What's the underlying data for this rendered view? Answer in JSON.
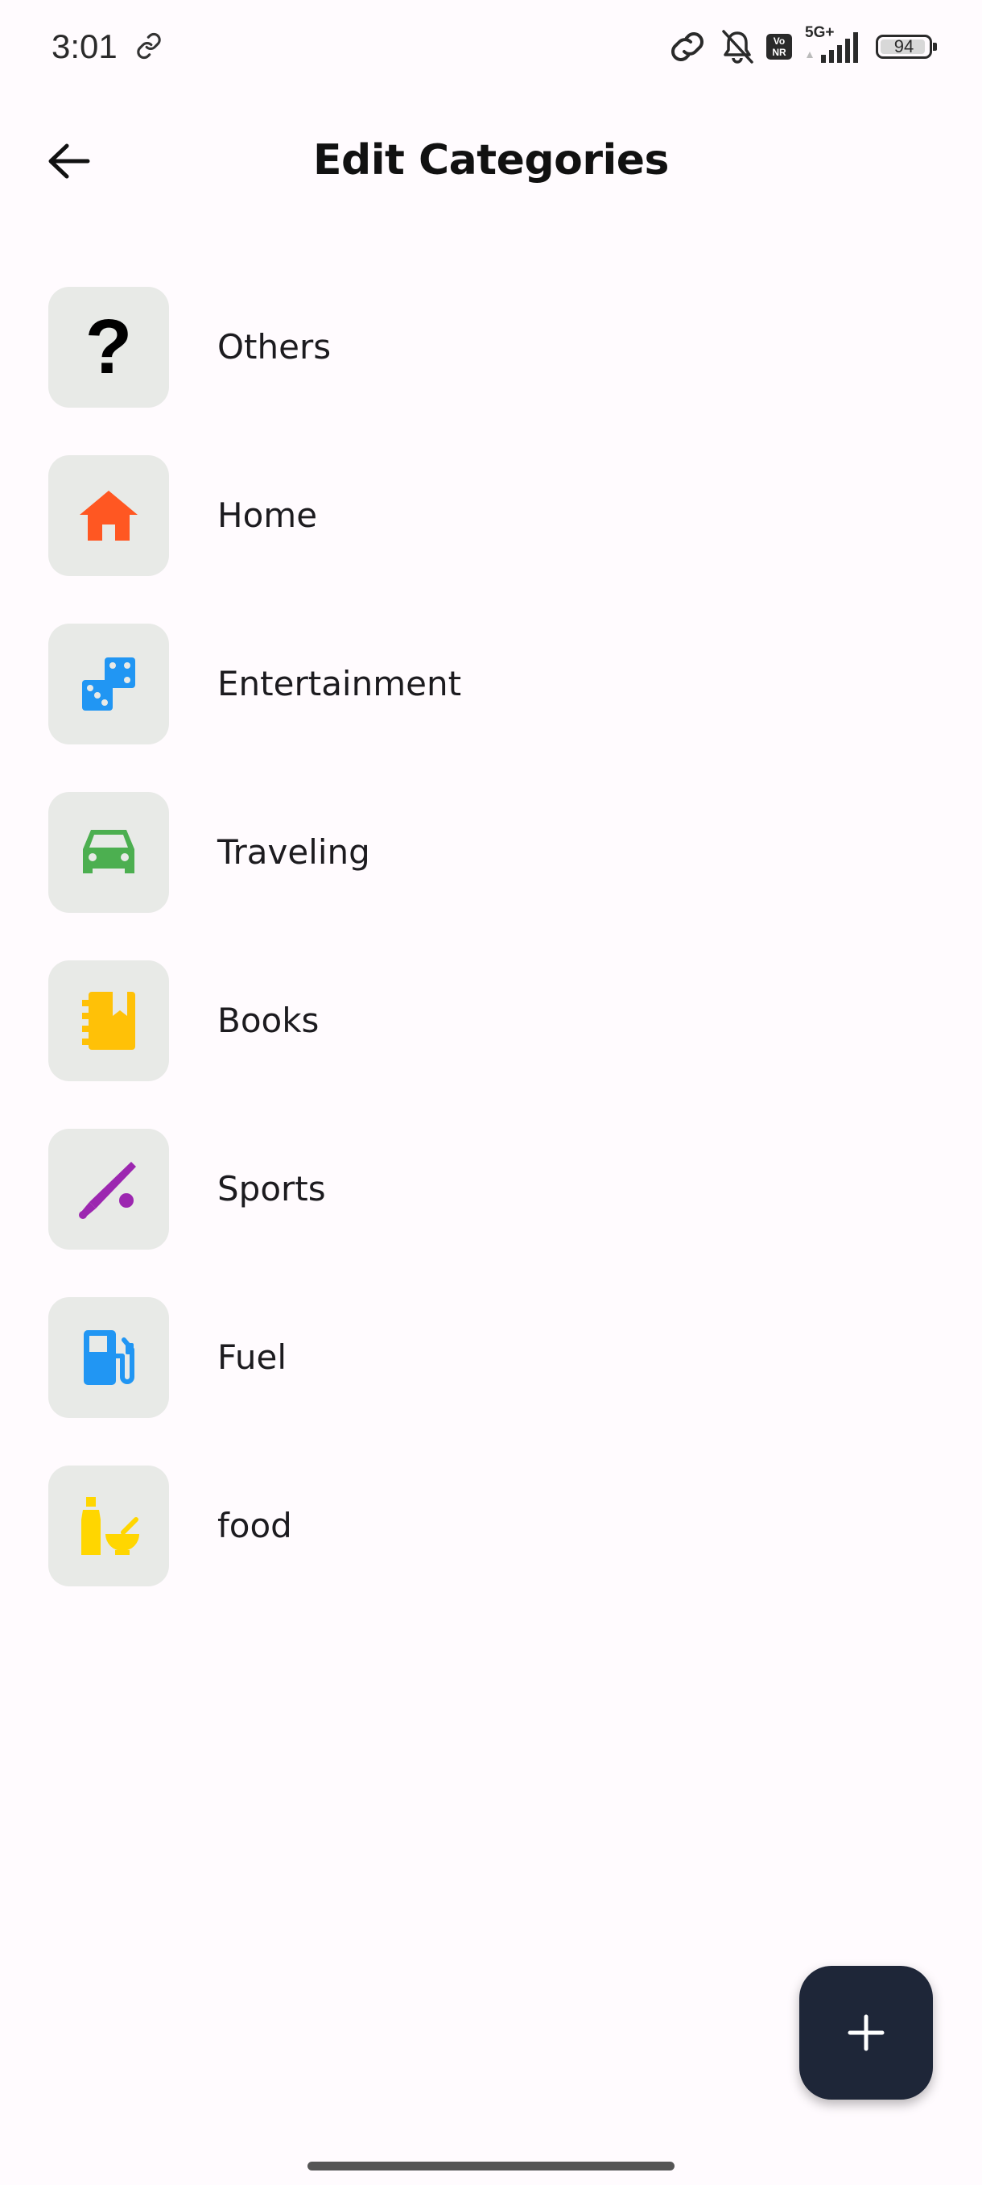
{
  "status_bar": {
    "time": "3:01",
    "network_label": "5G+",
    "volte_top": "Vo",
    "volte_bottom": "NR",
    "battery_level": "94",
    "battery_fraction": 0.94
  },
  "app_bar": {
    "title": "Edit Categories",
    "back_icon": "arrow-back-icon"
  },
  "categories": [
    {
      "label": "Others",
      "icon": "question-mark-icon",
      "icon_color": "#000000",
      "glyph": "?"
    },
    {
      "label": "Home",
      "icon": "house-icon",
      "icon_color": "#FF5722"
    },
    {
      "label": "Entertainment",
      "icon": "dice-icon",
      "icon_color": "#2196F3"
    },
    {
      "label": "Traveling",
      "icon": "car-icon",
      "icon_color": "#4CAF50"
    },
    {
      "label": "Books",
      "icon": "book-icon",
      "icon_color": "#FFC107"
    },
    {
      "label": "Sports",
      "icon": "baseball-bat-icon",
      "icon_color": "#9C27B0"
    },
    {
      "label": "Fuel",
      "icon": "gas-pump-icon",
      "icon_color": "#2196F3"
    },
    {
      "label": "food",
      "icon": "condiments-icon",
      "icon_color": "#FFD600"
    }
  ],
  "fab": {
    "icon": "plus-icon",
    "background": "#1E2638"
  },
  "colors": {
    "background": "#FFFBFE",
    "icon_tile": "#E8EAE7"
  }
}
